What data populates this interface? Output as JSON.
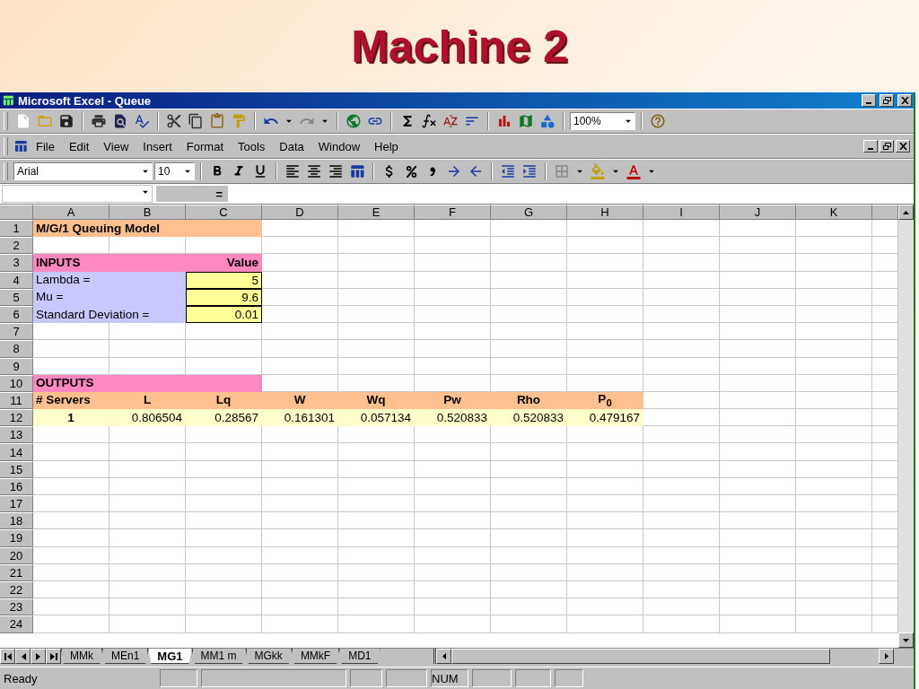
{
  "slide_title": "Machine 2",
  "window": {
    "title": "Microsoft Excel - Queue"
  },
  "zoom": "100%",
  "menu": [
    "File",
    "Edit",
    "View",
    "Insert",
    "Format",
    "Tools",
    "Data",
    "Window",
    "Help"
  ],
  "font": {
    "name": "Arial",
    "size": "10"
  },
  "formula_bar": {
    "equals": "="
  },
  "columns": [
    "A",
    "B",
    "C",
    "D",
    "E",
    "F",
    "G",
    "H",
    "I",
    "J",
    "K"
  ],
  "rows": [
    {
      "number": "1",
      "cells": [
        {
          "kind": "title",
          "text": "M/G/1 Queuing Model"
        },
        {
          "kind": "title"
        },
        {
          "kind": "title"
        }
      ]
    },
    {
      "number": "2"
    },
    {
      "number": "3",
      "cells": [
        {
          "kind": "section",
          "text": "INPUTS"
        },
        {
          "kind": "section"
        },
        {
          "kind": "section-right",
          "text": "Value"
        }
      ]
    },
    {
      "number": "4",
      "cells": [
        {
          "kind": "label",
          "text": "Lambda ="
        },
        {
          "kind": "label"
        },
        {
          "kind": "input",
          "text": "5"
        }
      ]
    },
    {
      "number": "5",
      "cells": [
        {
          "kind": "label",
          "text": "Mu ="
        },
        {
          "kind": "label"
        },
        {
          "kind": "input",
          "text": "9.6"
        }
      ]
    },
    {
      "number": "6",
      "cells": [
        {
          "kind": "label",
          "text": "Standard Deviation ="
        },
        {
          "kind": "label"
        },
        {
          "kind": "input",
          "text": "0.01"
        }
      ]
    },
    {
      "number": "7"
    },
    {
      "number": "8"
    },
    {
      "number": "9"
    },
    {
      "number": "10",
      "cells": [
        {
          "kind": "section",
          "text": "OUTPUTS"
        },
        {
          "kind": "section"
        },
        {
          "kind": "section"
        }
      ]
    },
    {
      "number": "11",
      "cells": [
        {
          "kind": "head-left",
          "text": "# Servers"
        },
        {
          "kind": "head",
          "text": "L"
        },
        {
          "kind": "head",
          "text": "Lq"
        },
        {
          "kind": "head",
          "text": "W"
        },
        {
          "kind": "head",
          "text": "Wq"
        },
        {
          "kind": "head",
          "text": "Pw"
        },
        {
          "kind": "head",
          "text": "Rho"
        },
        {
          "kind": "head",
          "text": "P$_{0}$"
        }
      ]
    },
    {
      "number": "12",
      "cells": [
        {
          "kind": "count",
          "text": "1"
        },
        {
          "kind": "value",
          "text": "0.806504"
        },
        {
          "kind": "value",
          "text": "0.28567"
        },
        {
          "kind": "value",
          "text": "0.161301"
        },
        {
          "kind": "value",
          "text": "0.057134"
        },
        {
          "kind": "value",
          "text": "0.520833"
        },
        {
          "kind": "value",
          "text": "0.520833"
        },
        {
          "kind": "value",
          "text": "0.479167"
        }
      ]
    },
    {
      "number": "13"
    },
    {
      "number": "14"
    },
    {
      "number": "15"
    },
    {
      "number": "16"
    },
    {
      "number": "17"
    },
    {
      "number": "18"
    },
    {
      "number": "19"
    },
    {
      "number": "20"
    },
    {
      "number": "21"
    },
    {
      "number": "22"
    },
    {
      "number": "23"
    },
    {
      "number": "24"
    }
  ],
  "sheet_tabs": [
    {
      "label": "MMk",
      "selected": false
    },
    {
      "label": "MEn1",
      "selected": false
    },
    {
      "label": "MG1",
      "selected": true
    },
    {
      "label": "MM1 m",
      "selected": false
    },
    {
      "label": "MGkk",
      "selected": false
    },
    {
      "label": "MMkF",
      "selected": false
    },
    {
      "label": "MD1",
      "selected": false
    }
  ],
  "status_bar": {
    "text": "Ready",
    "indicators": [
      "NUM"
    ]
  }
}
